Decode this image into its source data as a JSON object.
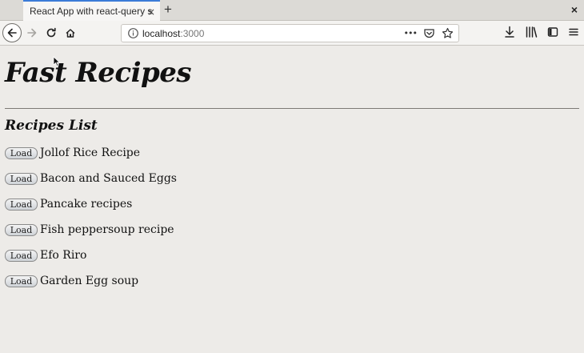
{
  "browser": {
    "tab_title": "React App with react-query s",
    "tab_close": "×",
    "new_tab": "+",
    "window_close": "×",
    "url_host": "localhost",
    "url_port": ":3000",
    "url_more": "•••"
  },
  "page": {
    "title": "Fast Recipes",
    "section_title": "Recipes List",
    "load_label": "Load",
    "recipes": [
      "Jollof Rice Recipe",
      "Bacon and Sauced Eggs",
      "Pancake recipes",
      "Fish peppersoup recipe",
      "Efo Riro",
      "Garden Egg soup"
    ]
  },
  "colors": {
    "page_background": "#edebe8",
    "tab_accent": "#3b7bd8"
  }
}
